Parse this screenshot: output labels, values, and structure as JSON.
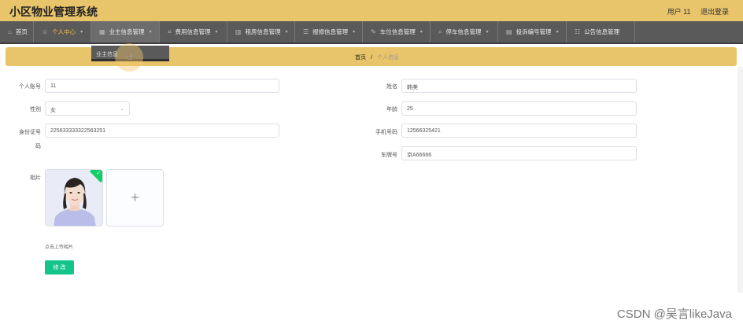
{
  "header": {
    "app_title": "小区物业管理系统",
    "user_label": "用户 11",
    "logout_label": "退出登录"
  },
  "nav": {
    "items": [
      {
        "label": "首页",
        "icon": "home-icon"
      },
      {
        "label": "个人中心",
        "icon": "user-icon"
      },
      {
        "label": "业主信息管理",
        "icon": "building-icon"
      },
      {
        "label": "费用信息管理",
        "icon": "crop-icon"
      },
      {
        "label": "租房信息管理",
        "icon": "grid-icon"
      },
      {
        "label": "报修信息管理",
        "icon": "list-icon"
      },
      {
        "label": "车位信息管理",
        "icon": "edit-icon"
      },
      {
        "label": "停车信息管理",
        "icon": "search-icon"
      },
      {
        "label": "投诉编号管理",
        "icon": "chart-icon"
      },
      {
        "label": "公告信息管理",
        "icon": "sliders-icon"
      }
    ],
    "dropdown_item": "业主信息"
  },
  "breadcrumb": {
    "home": "首页",
    "separator": "/",
    "current": "个人信息"
  },
  "form": {
    "account_label": "个人账号",
    "account_value": "11",
    "name_label": "姓名",
    "name_value": "韩美",
    "gender_label": "性别",
    "gender_value": "女",
    "age_label": "年龄",
    "age_value": "25",
    "id_label_line1": "身份证号",
    "id_label_line2": "码",
    "id_value": "225633333322563251",
    "phone_label": "手机号码",
    "phone_value": "12566325421",
    "plate_label": "车牌号",
    "plate_value": "京A66666",
    "photo_label": "相片",
    "upload_plus": "+",
    "upload_tip": "点击上传相片",
    "save_label": "修 改"
  },
  "watermark": "CSDN @吴言likeJava",
  "colors": {
    "header_bg": "#e8c46a",
    "nav_bg": "#5a5a5a",
    "active_nav": "#f0c050",
    "save_btn": "#13c58a"
  }
}
